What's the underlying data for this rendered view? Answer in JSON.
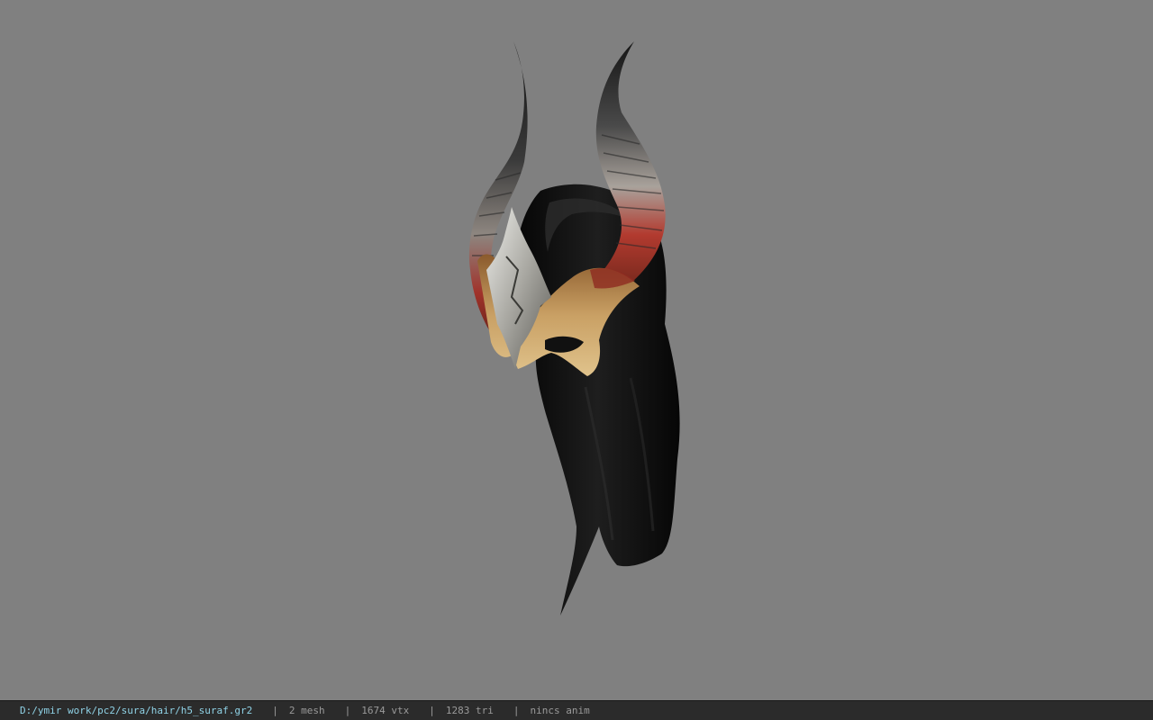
{
  "viewport": {
    "background_color": "#808080",
    "model_name": "hair helmet with horns"
  },
  "statusbar": {
    "file_path": "D:/ymir work/pc2/sura/hair/h5_suraf.gr2",
    "separator": "|",
    "mesh_count": "2 mesh",
    "vertex_count": "1674 vtx",
    "triangle_count": "1283 tri",
    "anim_status": "nincs anim",
    "path_color": "#8fd2e6",
    "text_color": "#9a9a9a"
  }
}
